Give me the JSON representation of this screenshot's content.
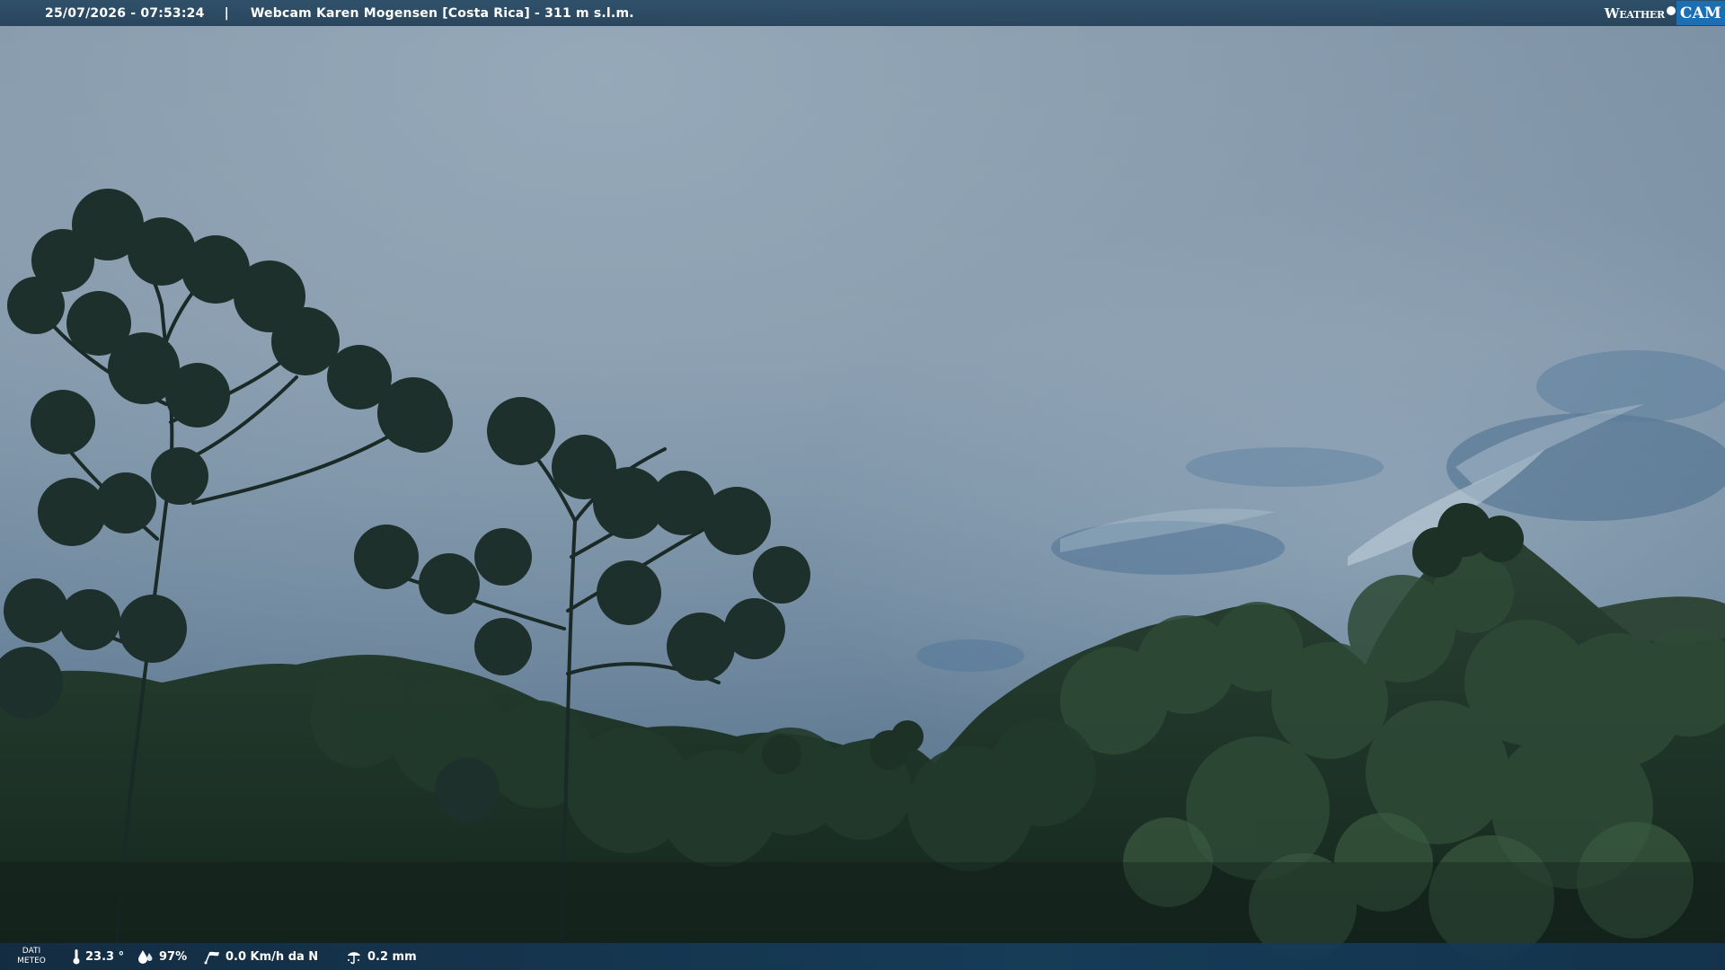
{
  "overlay": {
    "datetime": "25/07/2026 - 07:53:24",
    "separator": "|",
    "title": "Webcam Karen Mogensen [Costa Rica]  - 311 m s.l.m.",
    "logo": {
      "weather": "Weather",
      "cam": "CAM",
      "brand_blue": "#1d6fb3"
    }
  },
  "meteo": {
    "label_line1": "DATI",
    "label_line2": "METEO",
    "temperature": "23.3 °",
    "humidity": "97%",
    "wind": "0.0 Km/h da N",
    "rain": "0.2 mm",
    "icons": [
      "thermometer-icon",
      "humidity-icon",
      "wind-icon",
      "rain-gauge-icon"
    ]
  }
}
